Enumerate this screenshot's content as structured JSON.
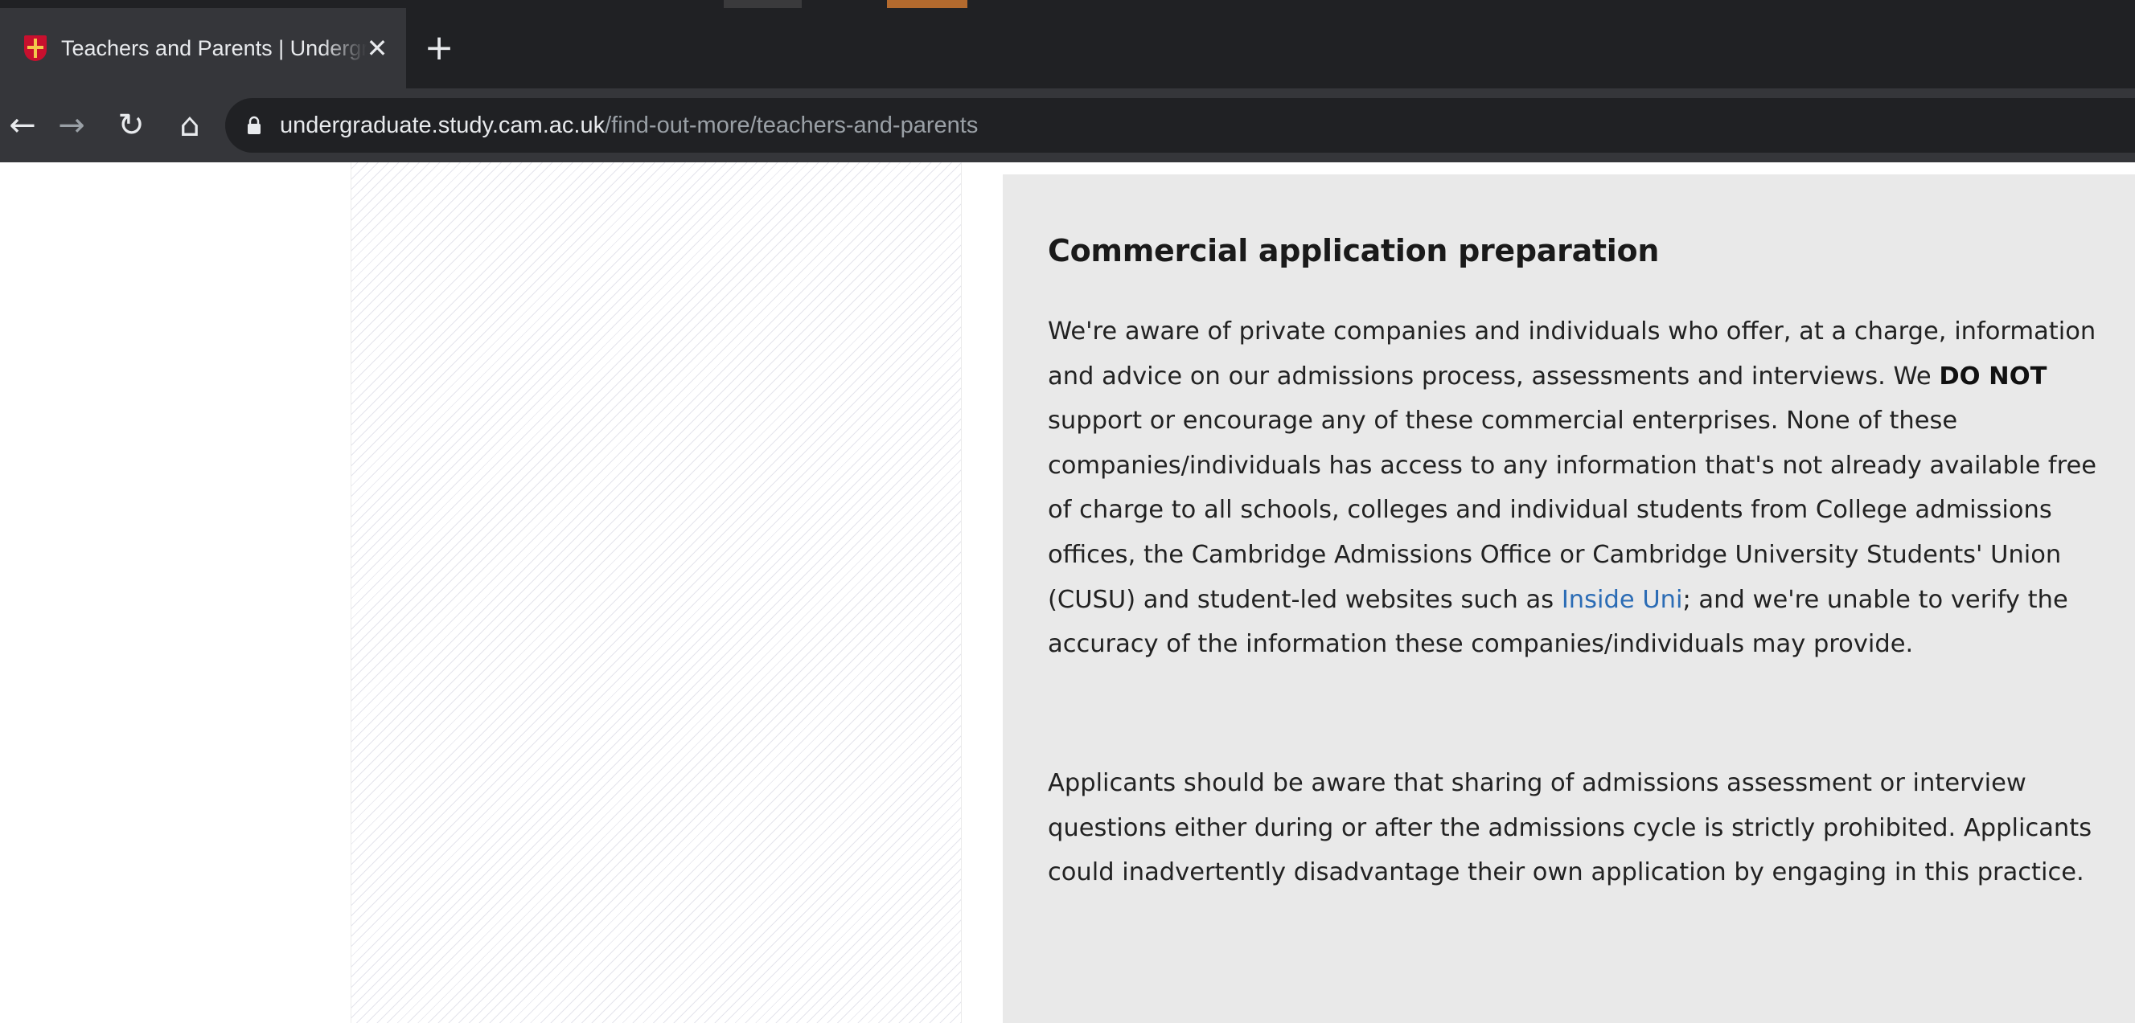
{
  "browser": {
    "tab": {
      "title": "Teachers and Parents | Undergraduate",
      "close_symbol": "✕",
      "favicon": "university-crest-icon"
    },
    "new_tab_symbol": "+",
    "toolbar": {
      "back_symbol": "←",
      "forward_symbol": "→",
      "reload_symbol": "↻",
      "home_symbol": "⌂"
    },
    "address_bar": {
      "host": "undergraduate.study.cam.ac.uk",
      "path": "/find-out-more/teachers-and-parents",
      "security_icon": "lock-icon"
    }
  },
  "panel": {
    "heading": "Commercial application preparation",
    "paragraph_1": {
      "text_before_bold": "We're aware of private companies and individuals who offer, at a charge, information and advice on our admissions process, assessments and interviews. We ",
      "bold": "DO NOT",
      "text_after_bold": " support or encourage any of these commercial enterprises. None of these companies/individuals has access to any information that's not already available free of charge to all schools, colleges and individual students from College admissions offices, the Cambridge Admissions Office or Cambridge University Students' Union (CUSU) and student-led websites such as ",
      "link_text": "Inside Uni",
      "text_after_link": "; and we're unable to verify the accuracy of the information these companies/individuals may provide."
    },
    "paragraph_2": "Applicants should be aware that sharing of admissions assessment or interview questions either during or after the admissions cycle is strictly prohibited. Applicants could inadvertently disadvantage their own application by engaging in this practice."
  },
  "colors": {
    "chrome_dark": "#202124",
    "chrome_tab": "#35363a",
    "panel_background": "#e9e9e9",
    "link": "#2b6cb5"
  }
}
